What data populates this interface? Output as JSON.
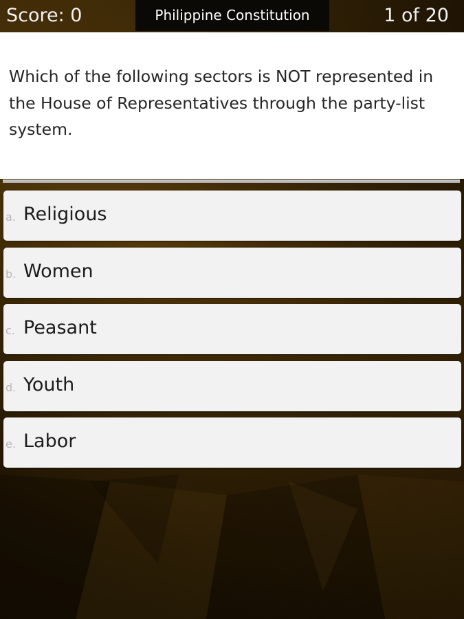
{
  "header": {
    "score": "Score: 0",
    "quiz_title": "Philippine Constitution",
    "progress": "1 of 20"
  },
  "question": {
    "text": "Which of the following sectors is NOT represented in the House of Representatives through the party-list system."
  },
  "answers": [
    {
      "letter": "a.",
      "label": "Religious"
    },
    {
      "letter": "b.",
      "label": "Women"
    },
    {
      "letter": "c.",
      "label": "Peasant"
    },
    {
      "letter": "d.",
      "label": "Youth"
    },
    {
      "letter": "e.",
      "label": "Labor"
    }
  ],
  "colors": {
    "background": "#2b1c04",
    "title_bar": "#0b0905",
    "answer_card": "#f2f2f2",
    "question_panel": "#ffffff"
  }
}
